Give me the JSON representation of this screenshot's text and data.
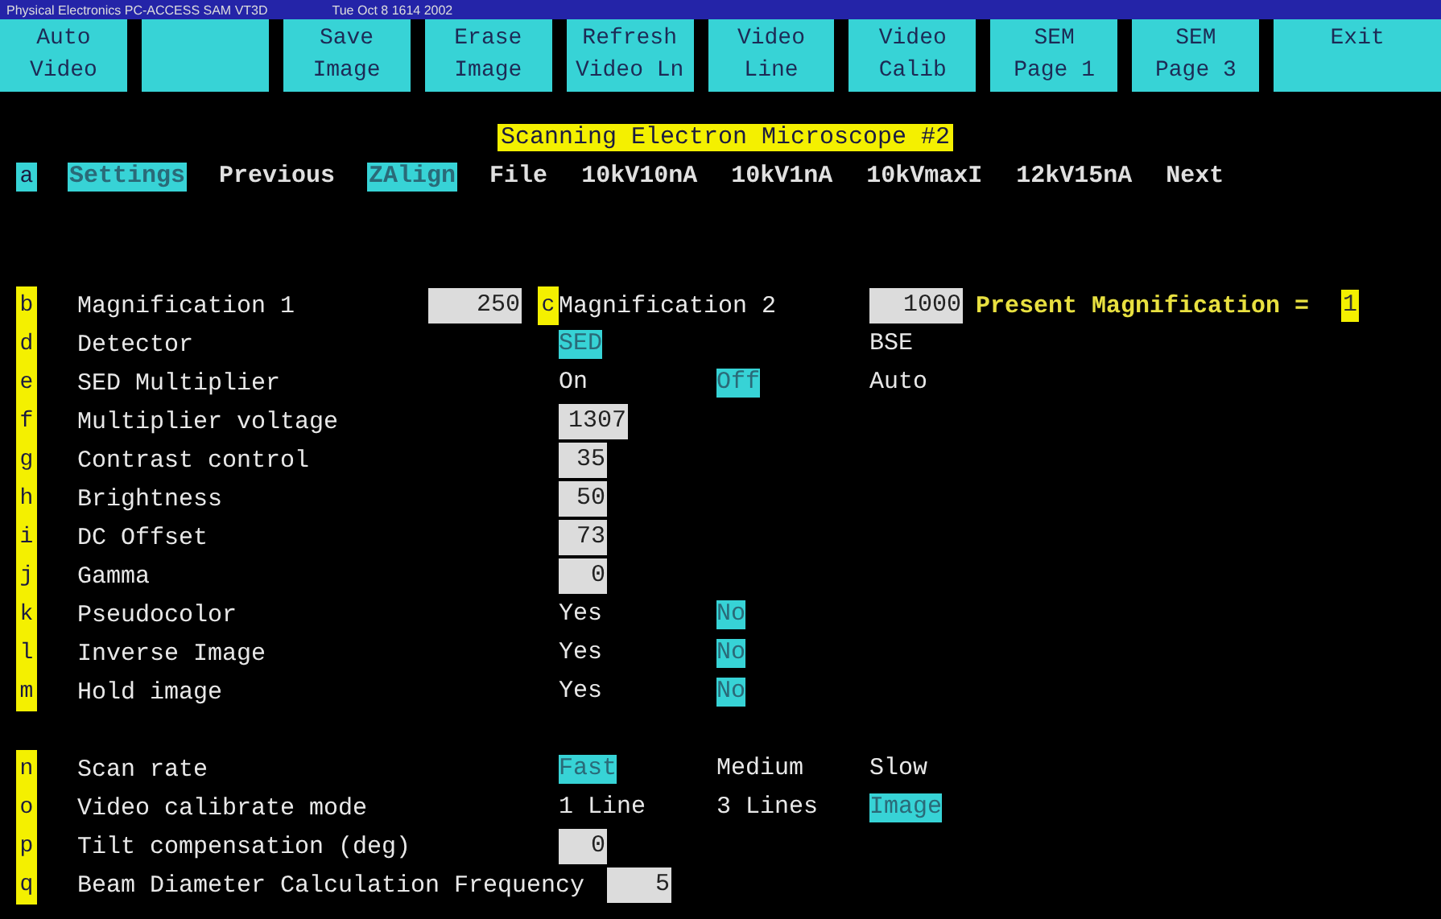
{
  "window": {
    "title": "Physical Electronics PC-ACCESS SAM VT3D",
    "datetime": "Tue Oct 8 1614 2002"
  },
  "buttons": [
    {
      "lines": [
        "Auto",
        "Video"
      ]
    },
    {
      "kind": "blank"
    },
    {
      "lines": [
        "Save",
        "Image"
      ]
    },
    {
      "lines": [
        "Erase",
        "Image"
      ]
    },
    {
      "lines": [
        "Refresh",
        "Video Ln"
      ]
    },
    {
      "lines": [
        "Video",
        "Line"
      ]
    },
    {
      "lines": [
        "Video",
        "Calib"
      ]
    },
    {
      "lines": [
        "SEM",
        "Page 1"
      ]
    },
    {
      "lines": [
        "SEM",
        "Page 3"
      ]
    },
    {
      "lines": [
        "Exit"
      ]
    }
  ],
  "heading": "Scanning Electron Microscope #2",
  "menu": {
    "key": "a",
    "items": [
      {
        "label": "Settings",
        "selected": true
      },
      {
        "label": "Previous",
        "selected": false
      },
      {
        "label": "ZAlign",
        "selected": true
      },
      {
        "label": "File",
        "selected": false
      },
      {
        "label": "10kV10nA",
        "selected": false
      },
      {
        "label": "10kV1nA",
        "selected": false
      },
      {
        "label": "10kVmaxI",
        "selected": false
      },
      {
        "label": "12kV15nA",
        "selected": false
      },
      {
        "label": "Next",
        "selected": false
      }
    ]
  },
  "groups": [
    {
      "rows": [
        {
          "kind": "magnification",
          "key": "b",
          "label": "Magnification 1",
          "value": "250",
          "key2": "c",
          "label2": "Magnification 2",
          "value2": "1000",
          "present_label": "Present Magnification =",
          "present_value": "1"
        },
        {
          "kind": "split",
          "key": "d",
          "label": "Detector",
          "options": [
            {
              "label": "SED",
              "selected": true
            },
            {
              "label": "BSE",
              "selected": false
            }
          ]
        },
        {
          "kind": "options",
          "key": "e",
          "label": "SED Multiplier",
          "options": [
            {
              "label": "On",
              "selected": false
            },
            {
              "label": "Off",
              "selected": true
            },
            {
              "label": "Auto",
              "selected": false
            }
          ]
        },
        {
          "kind": "number",
          "key": "f",
          "label": "Multiplier voltage",
          "value": "1307"
        },
        {
          "kind": "number",
          "key": "g",
          "label": "Contrast control",
          "value": "35"
        },
        {
          "kind": "number",
          "key": "h",
          "label": "Brightness",
          "value": "50"
        },
        {
          "kind": "number",
          "key": "i",
          "label": "DC Offset",
          "value": "73"
        },
        {
          "kind": "number",
          "key": "j",
          "label": "Gamma",
          "value": "0"
        },
        {
          "kind": "options",
          "key": "k",
          "label": "Pseudocolor",
          "options": [
            {
              "label": "Yes",
              "selected": false
            },
            {
              "label": "No",
              "selected": true
            }
          ]
        },
        {
          "kind": "options",
          "key": "l",
          "label": "Inverse Image",
          "options": [
            {
              "label": "Yes",
              "selected": false
            },
            {
              "label": "No",
              "selected": true
            }
          ]
        },
        {
          "kind": "options",
          "key": "m",
          "label": "Hold image",
          "options": [
            {
              "label": "Yes",
              "selected": false
            },
            {
              "label": "No",
              "selected": true
            }
          ]
        }
      ]
    },
    {
      "rows": [
        {
          "kind": "options",
          "key": "n",
          "label": "Scan rate",
          "options": [
            {
              "label": "Fast",
              "selected": true
            },
            {
              "label": "Medium",
              "selected": false
            },
            {
              "label": "Slow",
              "selected": false
            }
          ]
        },
        {
          "kind": "options",
          "key": "o",
          "label": "Video calibrate mode",
          "options": [
            {
              "label": "1 Line",
              "selected": false
            },
            {
              "label": "3 Lines",
              "selected": false
            },
            {
              "label": "Image",
              "selected": true
            }
          ]
        },
        {
          "kind": "number",
          "key": "p",
          "label": "Tilt compensation (deg)",
          "value": "0"
        },
        {
          "kind": "inline",
          "key": "q",
          "label": "Beam Diameter Calculation Frequency",
          "value": "5"
        }
      ]
    }
  ]
}
